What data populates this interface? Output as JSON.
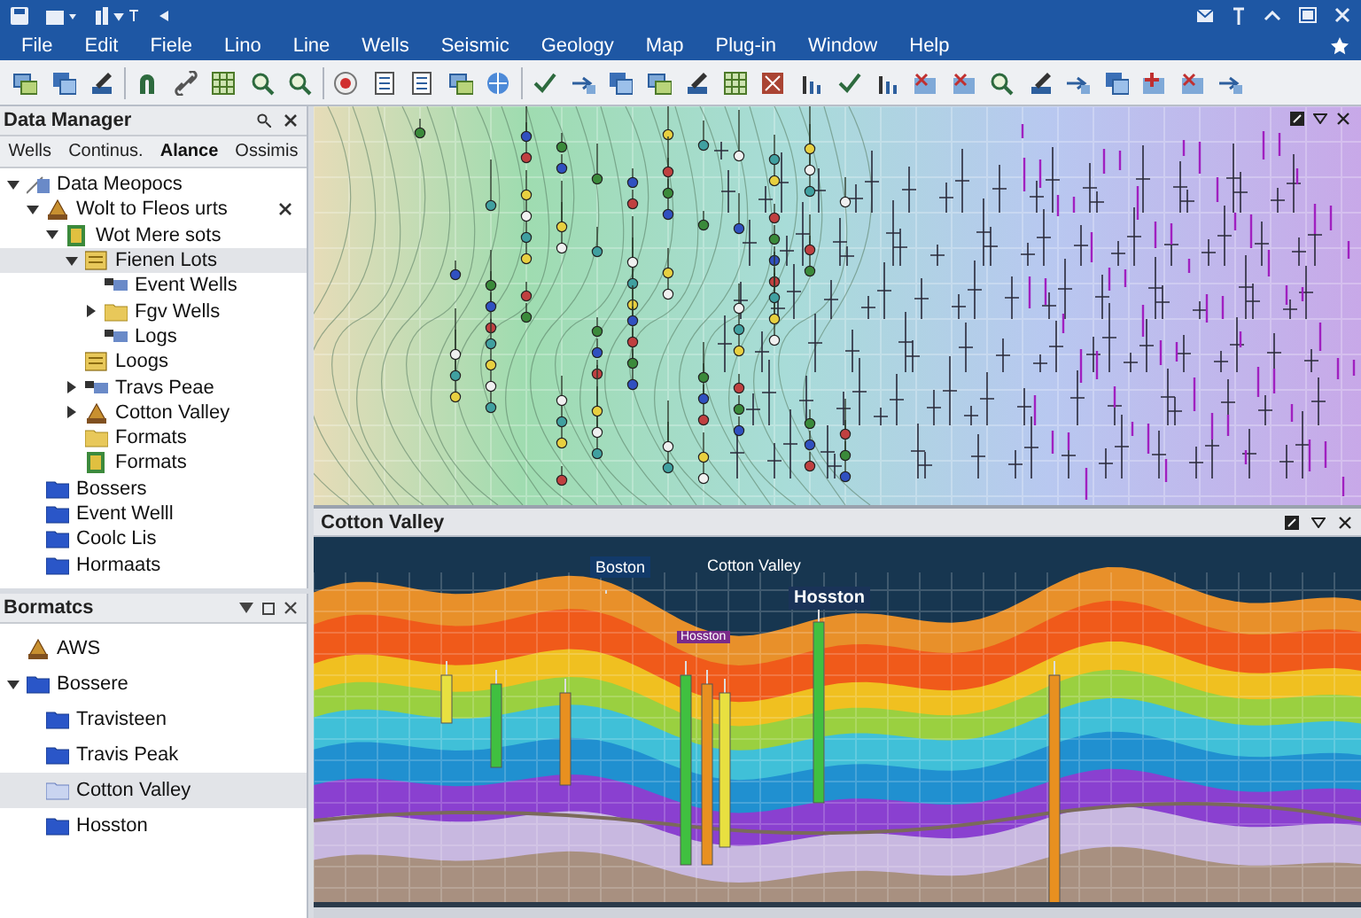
{
  "menu": [
    "File",
    "Edit",
    "Fiele",
    "Lino",
    "Line",
    "Wells",
    "Seismic",
    "Geology",
    "Map",
    "Plug-in",
    "Window",
    "Help"
  ],
  "data_manager": {
    "title": "Data Manager",
    "tabs": [
      {
        "label": "Wells",
        "selected": false
      },
      {
        "label": "Continus.",
        "selected": false
      },
      {
        "label": "Alance",
        "selected": true
      },
      {
        "label": "Ossimis",
        "selected": false
      }
    ],
    "tree": [
      {
        "label": "Data Meopocs",
        "kind": "doc",
        "selected": false,
        "expanded": true,
        "children": [
          {
            "label": "Wolt to Fleos urts",
            "kind": "well",
            "selected": false,
            "expanded": true,
            "closable": true,
            "children": [
              {
                "label": "Wot Mere sots",
                "kind": "stack",
                "selected": false,
                "expanded": true,
                "children": [
                  {
                    "label": "Fienen Lots",
                    "kind": "log",
                    "selected": true,
                    "expanded": true,
                    "children": [
                      {
                        "label": "Event Wells",
                        "kind": "data",
                        "selected": false
                      },
                      {
                        "label": "Fgv Wells",
                        "kind": "folder",
                        "selected": false,
                        "expanded": false
                      },
                      {
                        "label": "Logs",
                        "kind": "data",
                        "selected": false
                      }
                    ]
                  },
                  {
                    "label": "Loogs",
                    "kind": "log",
                    "selected": false
                  },
                  {
                    "label": "Travs Peae",
                    "kind": "data",
                    "selected": false,
                    "expanded": false
                  },
                  {
                    "label": "Cotton Valley",
                    "kind": "well",
                    "selected": false,
                    "expanded": false
                  },
                  {
                    "label": "Formats",
                    "kind": "folder",
                    "selected": false
                  },
                  {
                    "label": "Formats",
                    "kind": "stack",
                    "selected": false
                  }
                ]
              }
            ]
          },
          {
            "label": "Bossers",
            "kind": "blue-folder",
            "selected": false
          },
          {
            "label": "Event Welll",
            "kind": "blue-folder",
            "selected": false
          },
          {
            "label": "Coolc Lis",
            "kind": "blue-folder",
            "selected": false
          },
          {
            "label": "Hormaats",
            "kind": "blue-folder",
            "selected": false
          }
        ]
      }
    ]
  },
  "formations": {
    "title": "Bormatcs",
    "tree": [
      {
        "label": "AWS",
        "kind": "well",
        "selected": false
      },
      {
        "label": "Bossere",
        "kind": "blue-folder",
        "selected": false,
        "expanded": true,
        "children": [
          {
            "label": "Travisteen",
            "kind": "blue-folder",
            "selected": false
          },
          {
            "label": "Travis Peak",
            "kind": "blue-folder",
            "selected": false
          },
          {
            "label": "Cotton Valley",
            "kind": "pale-folder",
            "selected": true
          },
          {
            "label": "Hosston",
            "kind": "blue-folder",
            "selected": false
          }
        ]
      }
    ]
  },
  "section": {
    "title": "Cotton Valley",
    "labels": [
      {
        "text": "Boston",
        "kind": "tag"
      },
      {
        "text": "Cotton Valley",
        "kind": "plain"
      },
      {
        "text": "Hosston",
        "kind": "heading"
      },
      {
        "text": "Hosston",
        "kind": "chip"
      }
    ]
  }
}
